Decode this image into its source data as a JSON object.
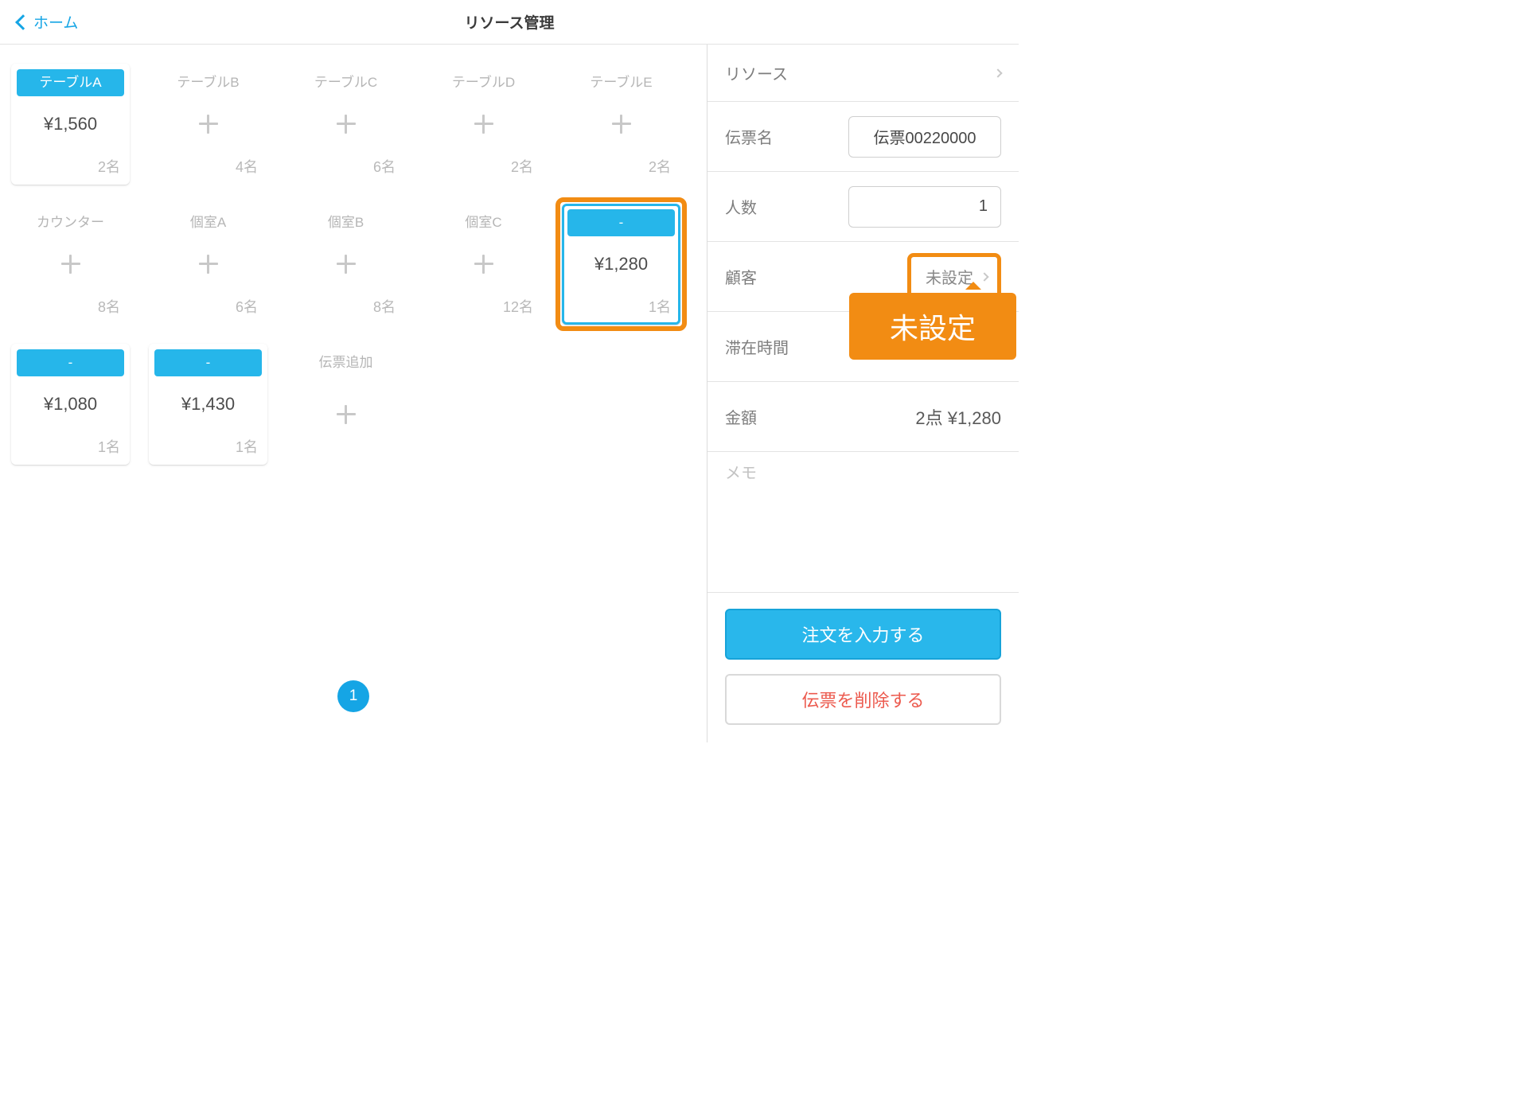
{
  "header": {
    "back_label": "ホーム",
    "title": "リソース管理"
  },
  "grid": {
    "tableA": {
      "name": "テーブルA",
      "price": "¥1,560",
      "seats": "2名"
    },
    "tableB": {
      "name": "テーブルB",
      "seats": "4名"
    },
    "tableC": {
      "name": "テーブルC",
      "seats": "6名"
    },
    "tableD": {
      "name": "テーブルD",
      "seats": "2名"
    },
    "tableE": {
      "name": "テーブルE",
      "seats": "2名"
    },
    "counter": {
      "name": "カウンター",
      "seats": "8名"
    },
    "roomA": {
      "name": "個室A",
      "seats": "6名"
    },
    "roomB": {
      "name": "個室B",
      "seats": "8名"
    },
    "roomC": {
      "name": "個室C",
      "seats": "12名"
    },
    "sel": {
      "name": "-",
      "price": "¥1,280",
      "seats": "1名"
    },
    "t1": {
      "name": "-",
      "price": "¥1,080",
      "seats": "1名"
    },
    "t2": {
      "name": "-",
      "price": "¥1,430",
      "seats": "1名"
    },
    "add": {
      "name": "伝票追加"
    }
  },
  "pager": {
    "current": "1"
  },
  "panel": {
    "resource_label": "リソース",
    "ticket_label": "伝票名",
    "ticket_value": "伝票00220000",
    "seats_label": "人数",
    "seats_value": "1",
    "customer_label": "顧客",
    "customer_value": "未設定",
    "callout": "未設定",
    "stay_label": "滞在時間",
    "amount_label": "金額",
    "amount_value": "2点  ¥1,280",
    "memo_label": "メモ"
  },
  "actions": {
    "order": "注文を入力する",
    "delete": "伝票を削除する"
  }
}
